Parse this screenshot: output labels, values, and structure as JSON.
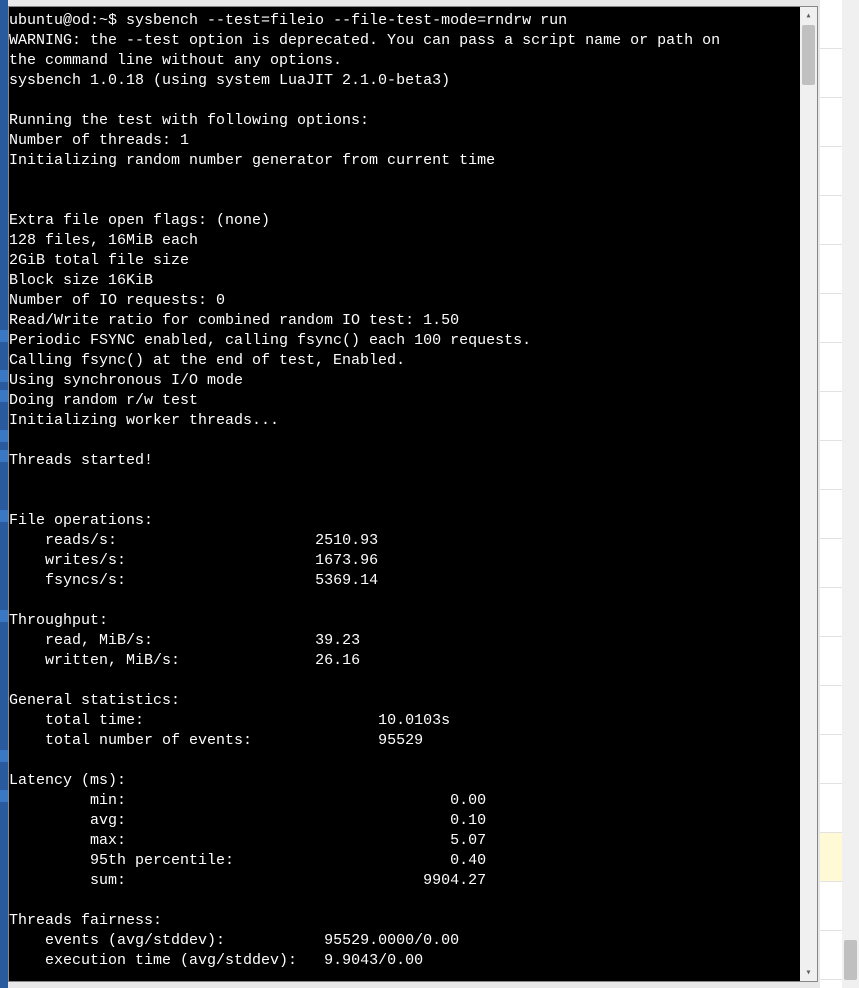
{
  "prompt": "ubuntu@od:~$ ",
  "command": "sysbench --test=fileio --file-test-mode=rndrw run",
  "warning_l1": "WARNING: the --test option is deprecated. You can pass a script name or path on",
  "warning_l2": "the command line without any options.",
  "version": "sysbench 1.0.18 (using system LuaJIT 2.1.0-beta3)",
  "run_header": "Running the test with following options:",
  "threads_line": "Number of threads: 1",
  "rng_line": "Initializing random number generator from current time",
  "flags_line": "Extra file open flags: (none)",
  "files_line": "128 files, 16MiB each",
  "total_size_line": "2GiB total file size",
  "block_size_line": "Block size 16KiB",
  "io_req_line": "Number of IO requests: 0",
  "rw_ratio_line": "Read/Write ratio for combined random IO test: 1.50",
  "fsync_line": "Periodic FSYNC enabled, calling fsync() each 100 requests.",
  "fsync_end_line": "Calling fsync() at the end of test, Enabled.",
  "sync_mode_line": "Using synchronous I/O mode",
  "doing_line": "Doing random r/w test",
  "init_workers": "Initializing worker threads...",
  "threads_started": "Threads started!",
  "fileops_header": "File operations:",
  "reads_label": "    reads/s:                      ",
  "reads_val": "2510.93",
  "writes_label": "    writes/s:                     ",
  "writes_val": "1673.96",
  "fsyncs_label": "    fsyncs/s:                     ",
  "fsyncs_val": "5369.14",
  "throughput_header": "Throughput:",
  "read_mib_label": "    read, MiB/s:                  ",
  "read_mib_val": "39.23",
  "written_mib_label": "    written, MiB/s:               ",
  "written_mib_val": "26.16",
  "genstats_header": "General statistics:",
  "total_time_label": "    total time:                          ",
  "total_time_val": "10.0103s",
  "total_events_label": "    total number of events:              ",
  "total_events_val": "95529",
  "latency_header": "Latency (ms):",
  "lat_min_label": "         min:                                    ",
  "lat_min_val": "0.00",
  "lat_avg_label": "         avg:                                    ",
  "lat_avg_val": "0.10",
  "lat_max_label": "         max:                                    ",
  "lat_max_val": "5.07",
  "lat_95_label": "         95th percentile:                        ",
  "lat_95_val": "0.40",
  "lat_sum_label": "         sum:                                 ",
  "lat_sum_val": "9904.27",
  "fairness_header": "Threads fairness:",
  "events_avg_label": "    events (avg/stddev):           ",
  "events_avg_val": "95529.0000/0.00",
  "exec_time_label": "    execution time (avg/stddev):   ",
  "exec_time_val": "9.9043/0.00"
}
